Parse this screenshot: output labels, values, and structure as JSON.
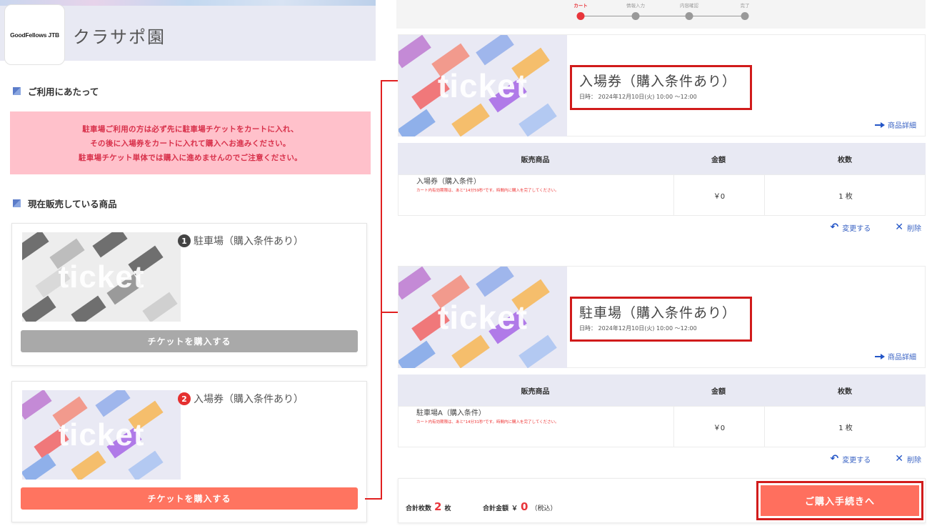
{
  "left": {
    "logo_text": "GoodFellows JTB",
    "park_name": "クラサポ園",
    "section_notice": "ご利用にあたって",
    "notice_lines": [
      "駐車場ご利用の方は必ず先に駐車場チケットをカートに入れ、",
      "その後に入場券をカートに入れて購入へお進みください。",
      "駐車場チケット単体では購入に進めませんのでご注意ください。"
    ],
    "section_products": "現在販売している商品",
    "products": [
      {
        "number": "1",
        "name": "駐車場（購入条件あり）",
        "thumb_text": "ticket",
        "button": "チケットを購入する"
      },
      {
        "number": "2",
        "name": "入場券（購入条件あり）",
        "thumb_text": "ticket",
        "button": "チケットを購入する"
      }
    ]
  },
  "steps": [
    "カート",
    "情報入力",
    "内容確認",
    "完了"
  ],
  "cart": {
    "items": [
      {
        "title": "入場券（購入条件あり）",
        "date": "日時： 2024年12月10日(火) 10:00 ～12:00",
        "thumb_text": "ticket",
        "detail_link": "商品詳細",
        "row_name": "入場券（購入条件）",
        "row_warning": "カート内有効期限は、あと\"14分59秒\"です。時間内に購入を完了してください。",
        "price": "￥0",
        "qty": "1 枚"
      },
      {
        "title": "駐車場（購入条件あり）",
        "date": "日時： 2024年12月10日(火) 10:00 ～12:00",
        "thumb_text": "ticket",
        "detail_link": "商品詳細",
        "row_name": "駐車場A（購入条件）",
        "row_warning": "カート内有効期限は、あと\"14分31秒\"です。時間内に購入を完了してください。",
        "price": "￥0",
        "qty": "1 枚"
      }
    ],
    "table_headers": [
      "販売商品",
      "金額",
      "枚数"
    ],
    "change_label": "変更する",
    "delete_label": "削除",
    "total_count_label": "合計枚数",
    "total_count": "2",
    "total_count_unit": "枚",
    "total_price_label": "合計金額",
    "total_price_prefix": "￥",
    "total_price": "0",
    "tax_note": "（税込）",
    "proceed_label": "ご購入手続きへ"
  },
  "colors": {
    "accent_red": "#e8353b",
    "buy_orange": "#ff7460",
    "buy_disabled": "#a9a9a9",
    "highlight_border": "#d11b1b",
    "link_blue": "#2456c7"
  }
}
